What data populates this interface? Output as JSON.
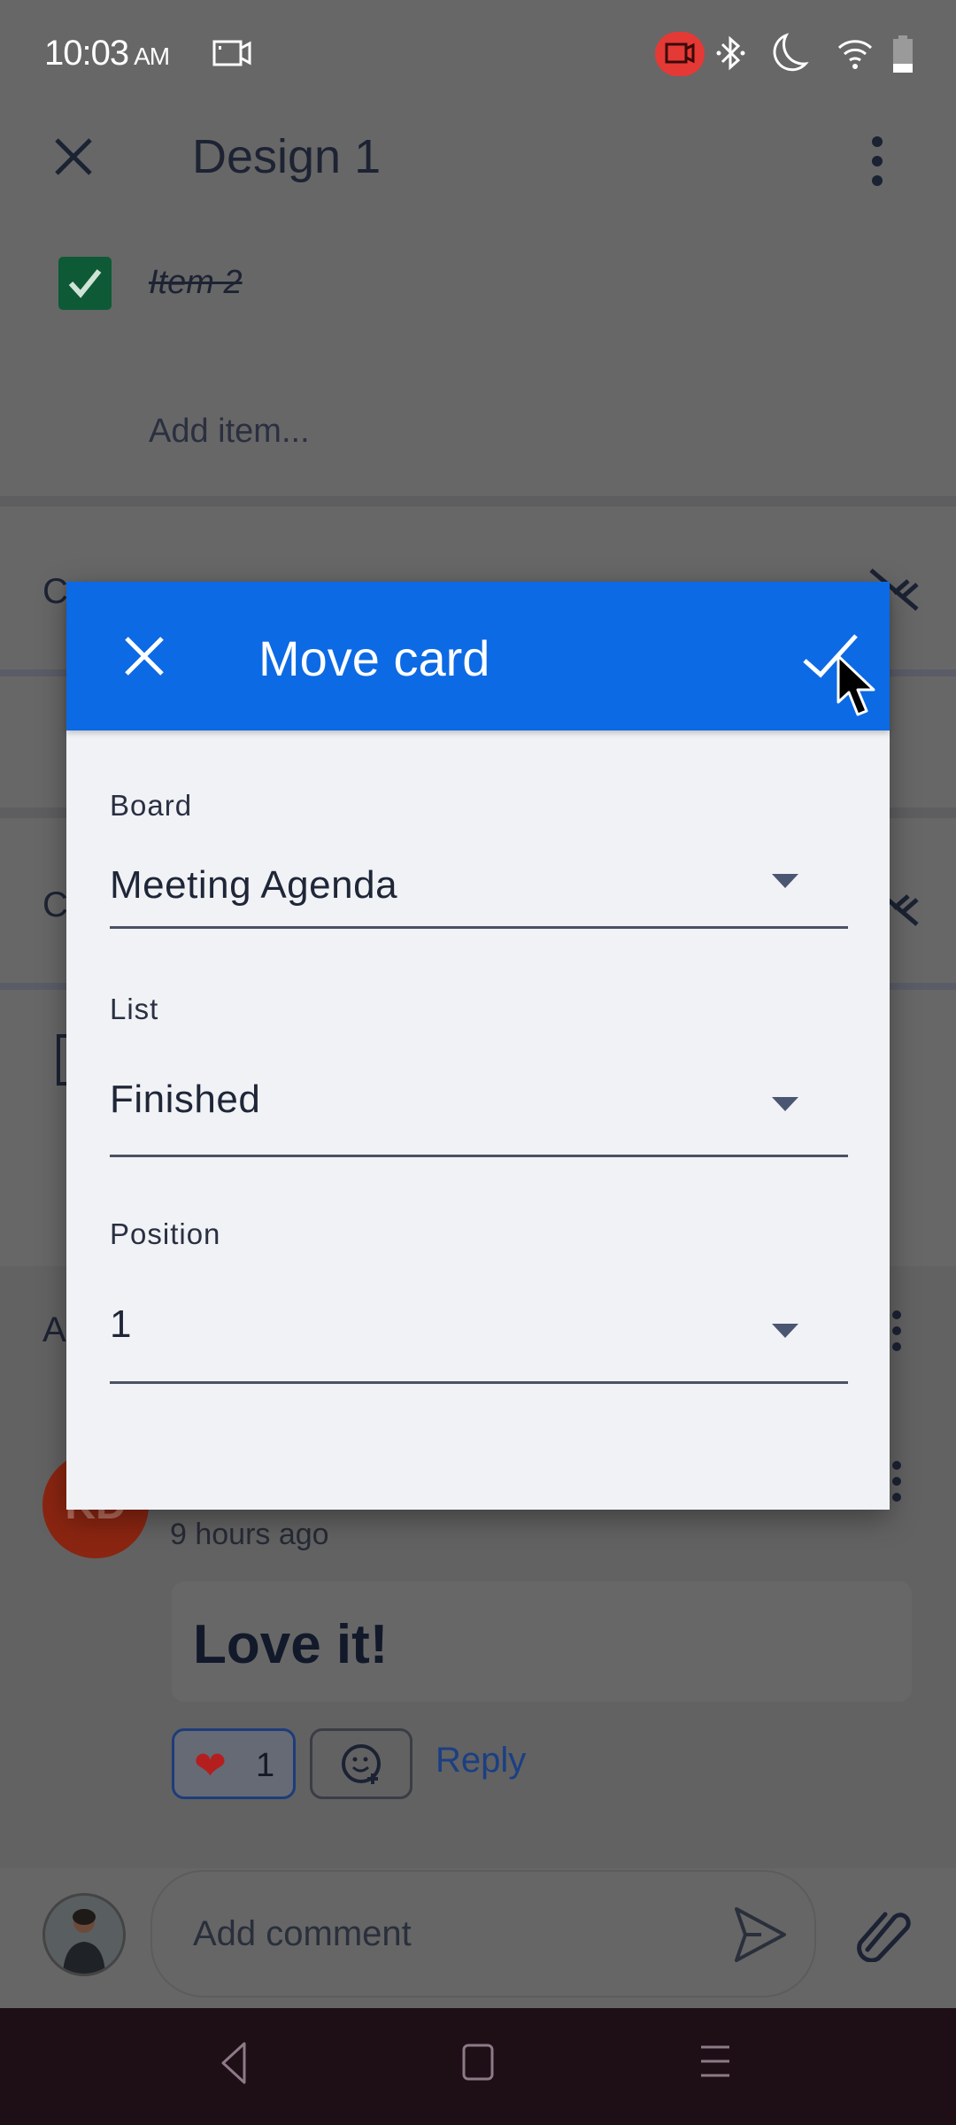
{
  "status_bar": {
    "time": "10:03",
    "ampm": "AM",
    "icons": [
      "screen-record-icon",
      "recording-indicator-icon",
      "bluetooth-icon",
      "do-not-disturb-moon-icon",
      "wifi-icon",
      "battery-icon"
    ],
    "record_color": "#e53935"
  },
  "card": {
    "title": "Design 1",
    "checklist_item": "Item 2",
    "checklist_item_checked": true,
    "add_item_placeholder": "Add item...",
    "partial_section_1": "C",
    "partial_section_2": "C",
    "partial_section_3": "A"
  },
  "comment": {
    "author_initials": "KD",
    "time_ago": "9 hours ago",
    "text": "Love it!",
    "reaction_emoji": "❤",
    "reaction_count": "1",
    "reply_label": "Reply"
  },
  "comment_bar": {
    "placeholder": "Add comment"
  },
  "modal": {
    "title": "Move card",
    "header_color": "#0c6ae4",
    "fields": [
      {
        "label": "Board",
        "value": "Meeting Agenda"
      },
      {
        "label": "List",
        "value": "Finished"
      },
      {
        "label": "Position",
        "value": "1"
      }
    ]
  },
  "nav_bar": {
    "icons": [
      "back-icon",
      "home-icon",
      "recents-icon"
    ]
  }
}
